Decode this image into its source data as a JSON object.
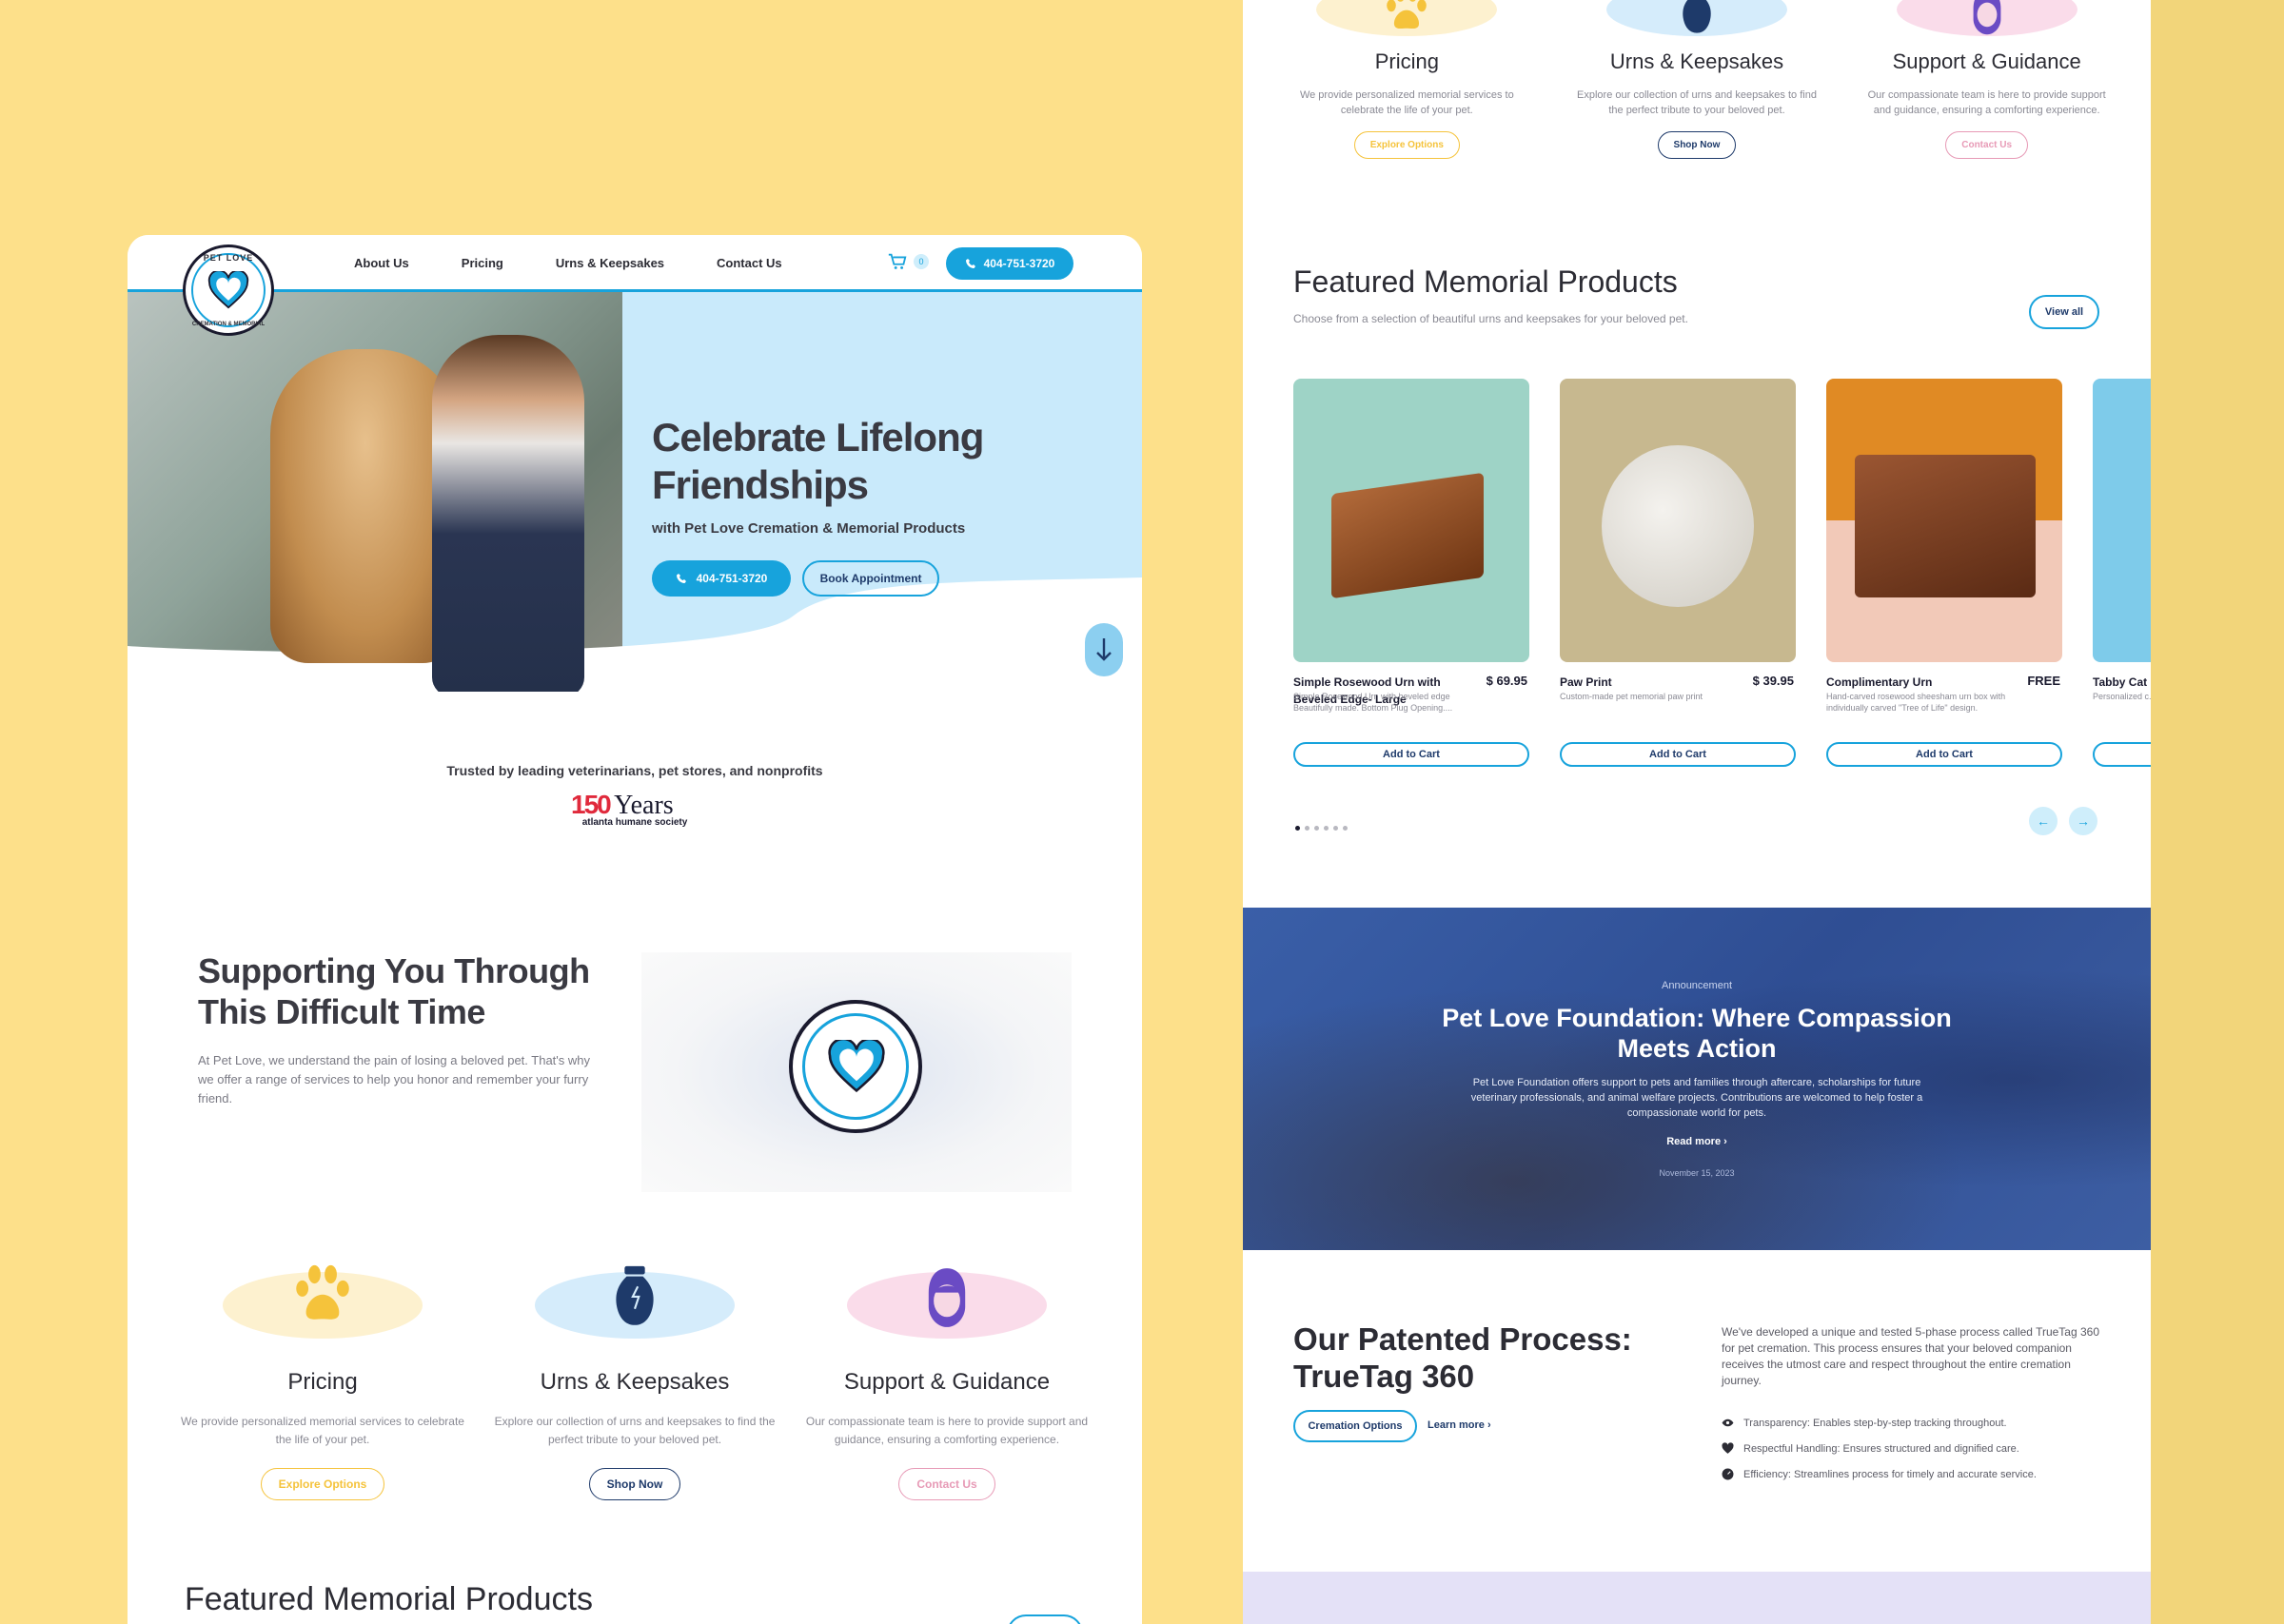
{
  "nav": {
    "links": [
      "About Us",
      "Pricing",
      "Urns & Keepsakes",
      "Contact Us"
    ],
    "cart_count": "0",
    "phone": "404-751-3720"
  },
  "logo": {
    "top_text": "PET LOVE",
    "bottom_text": "CREMATION & MEMORIAL"
  },
  "hero": {
    "title": "Celebrate Lifelong Friendships",
    "subtitle": "with Pet Love Cremation & Memorial Products",
    "call_label": "404-751-3720",
    "book_label": "Book Appointment"
  },
  "trusted": {
    "text": "Trusted by leading veterinarians, pet stores, and nonprofits",
    "badge_number": "150",
    "badge_word": "Years",
    "badge_org": "atlanta humane society"
  },
  "support": {
    "title": "Supporting You Through This Difficult Time",
    "text": "At Pet Love, we understand the pain of losing a beloved pet. That's why we offer a range of services to help you honor and remember your furry friend."
  },
  "services": [
    {
      "title": "Pricing",
      "text": "We provide personalized memorial services to celebrate the life of your pet.",
      "button": "Explore Options",
      "color": "#f5c33b",
      "blob": "#fdf1cf",
      "icon": "paw-icon"
    },
    {
      "title": "Urns & Keepsakes",
      "text": "Explore our collection of urns and keepsakes to find the perfect tribute to your beloved pet.",
      "button": "Shop Now",
      "color": "#1e3a6a",
      "blob": "#d5ecfb",
      "icon": "urn-icon"
    },
    {
      "title": "Support & Guidance",
      "text": "Our compassionate team is here to provide support and guidance, ensuring a comforting experience.",
      "button": "Contact Us",
      "color": "#e79ab6",
      "blob": "#fadcea",
      "icon": "support-agent-icon"
    }
  ],
  "featured": {
    "title": "Featured Memorial Products",
    "subtitle": "Choose from a selection of beautiful urns and keepsakes for your beloved pet.",
    "view_all": "View all",
    "add_to_cart": "Add to Cart",
    "products": [
      {
        "name": "Simple Rosewood Urn with Beveled Edge- Large",
        "price": "$ 69.95",
        "desc": "Simple Rosewood Urn with beveled edge Beautifully made. Bottom Plug Opening....",
        "bg": "#9ed3c6"
      },
      {
        "name": "Paw Print",
        "price": "$ 39.95",
        "desc": "Custom-made pet memorial paw print",
        "bg": "#c7b88f"
      },
      {
        "name": "Complimentary Urn",
        "price": "FREE",
        "desc": "Hand-carved rosewood sheesham urn box with individually carved \"Tree of Life\" design.",
        "bg": "#e79a3a"
      },
      {
        "name": "Tabby Cat",
        "price": "",
        "desc": "Personalized c... Wood photo fr...",
        "bg": "#7ecbea"
      }
    ]
  },
  "announcement": {
    "tag": "Announcement",
    "title": "Pet Love Foundation: Where Compassion Meets Action",
    "text": "Pet Love Foundation offers support to pets and families through aftercare, scholarships for future veterinary professionals, and animal welfare projects. Contributions are welcomed to help foster a compassionate world for pets.",
    "read_more": "Read more",
    "date": "November 15, 2023"
  },
  "patented": {
    "title": "Our Patented Process: TrueTag 360",
    "button": "Cremation Options",
    "learn_more": "Learn more",
    "text": "We've developed a unique and tested 5-phase process called TrueTag 360 for pet cremation. This process ensures that your beloved companion receives the utmost care and respect throughout the entire cremation journey.",
    "items": [
      {
        "text": "Transparency: Enables step-by-step tracking throughout.",
        "icon": "eye-icon"
      },
      {
        "text": "Respectful Handling: Ensures structured and dignified care.",
        "icon": "heart-icon"
      },
      {
        "text": "Efficiency: Streamlines process for timely and accurate service.",
        "icon": "gauge-icon"
      }
    ]
  }
}
